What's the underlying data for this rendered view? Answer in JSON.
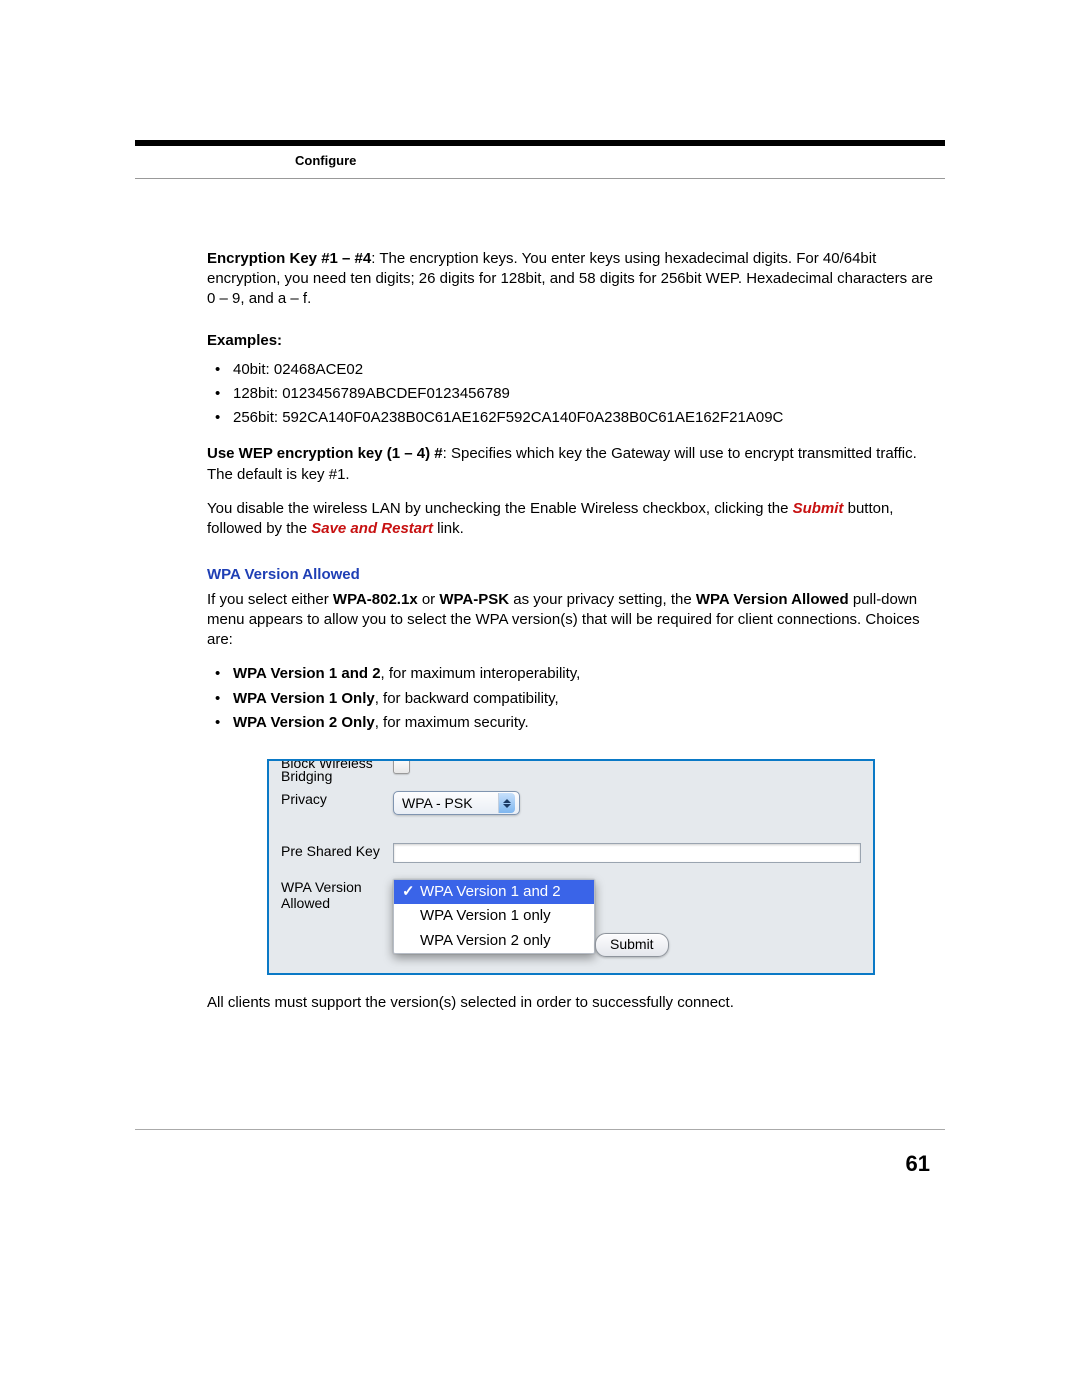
{
  "header": {
    "section": "Configure"
  },
  "body": {
    "enc_para_bold": "Encryption Key #1 – #4",
    "enc_para_rest": ": The encryption keys. You enter keys using hexadecimal digits. For 40/64bit encryption, you need ten digits; 26 digits for 128bit, and 58 digits for 256bit WEP. Hexadecimal characters are 0 – 9, and a – f.",
    "examples_heading": "Examples:",
    "examples": {
      "a": "40bit: 02468ACE02",
      "b": "128bit: 0123456789ABCDEF0123456789",
      "c": "256bit: 592CA140F0A238B0C61AE162F592CA140F0A238B0C61AE162F21A09C"
    },
    "use_wep_bold": "Use WEP encryption key (1 – 4) #",
    "use_wep_rest": ": Specifies which key the Gateway will use to encrypt transmitted traffic. The default is key #1.",
    "disable_pre": "You disable the wireless LAN by unchecking the Enable Wireless checkbox, clicking the ",
    "submit_word": "Submit",
    "disable_mid": " button, followed by the ",
    "save_restart": "Save and Restart",
    "disable_post": " link.",
    "wpa_heading": "WPA Version Allowed",
    "wpa_para_pre": "If you select either ",
    "wpa_para_b1": "WPA-802.1x",
    "wpa_para_mid1": " or ",
    "wpa_para_b2": "WPA-PSK",
    "wpa_para_mid2": " as your privacy setting, the ",
    "wpa_para_b3": "WPA Version Allowed",
    "wpa_para_post": " pull-down menu appears to allow you to select the WPA version(s) that will be required for client connections. Choices are:",
    "choices": {
      "a_b": "WPA Version 1 and 2",
      "a_r": ", for maximum interoperability,",
      "b_b": "WPA Version 1 Only",
      "b_r": ", for backward compatibility,",
      "c_b": "WPA Version 2 Only",
      "c_r": ", for maximum security."
    },
    "after_figure": "All clients must support the version(s) selected in order to successfully connect."
  },
  "figure": {
    "labels": {
      "block_wireless": "Block Wireless",
      "bridging": "Bridging",
      "privacy": "Privacy",
      "pre_shared_key": "Pre Shared Key",
      "wpa_version_allowed": "WPA Version Allowed"
    },
    "privacy_value": "WPA - PSK",
    "dropdown": {
      "opt1": "WPA Version 1 and 2",
      "opt2": "WPA Version 1 only",
      "opt3": "WPA Version 2 only"
    },
    "submit": "Submit"
  },
  "page_number": "61"
}
